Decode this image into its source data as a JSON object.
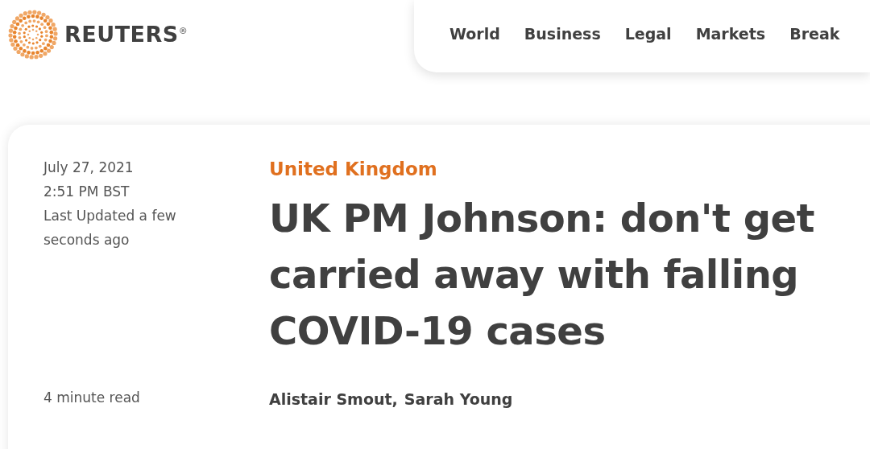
{
  "header": {
    "logo": "REUTERS",
    "logo_mark": "®",
    "nav": [
      {
        "label": "World"
      },
      {
        "label": "Business"
      },
      {
        "label": "Legal"
      },
      {
        "label": "Markets"
      },
      {
        "label": "Break"
      }
    ]
  },
  "article": {
    "date": "July 27, 2021",
    "time": "2:51 PM BST",
    "updated": "Last Updated a few seconds ago",
    "read_time": "4 minute read",
    "section": "United Kingdom",
    "headline": "UK PM Johnson: don't get carried away with falling COVID-19 cases",
    "authors": [
      {
        "name": "Alistair Smout,"
      },
      {
        "name": "Sarah Young"
      }
    ]
  }
}
